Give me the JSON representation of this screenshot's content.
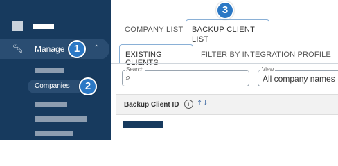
{
  "sidebar": {
    "manage_label": "Manage",
    "manage_icon": "wrench-icon",
    "companies_label": "Companies",
    "chevron_icon": "chevron-up-icon"
  },
  "callouts": [
    "1",
    "2",
    "3"
  ],
  "tabs": {
    "company_list": "COMPANY LIST",
    "backup_client_list": "BACKUP CLIENT LIST"
  },
  "subtabs": {
    "existing_clients": "EXISTING CLIENTS",
    "filter_by_integration": "FILTER BY INTEGRATION PROFILE"
  },
  "search": {
    "label": "Search",
    "icon": "search-icon"
  },
  "view": {
    "label": "View",
    "value": "All company names"
  },
  "table": {
    "column_header": "Backup Client ID",
    "info_icon": "info-icon",
    "sort_icon": "sort-icon"
  },
  "colors": {
    "sidebar": "#173a5e",
    "accent": "#2b78c5",
    "tab_border": "#8ab0d6"
  }
}
